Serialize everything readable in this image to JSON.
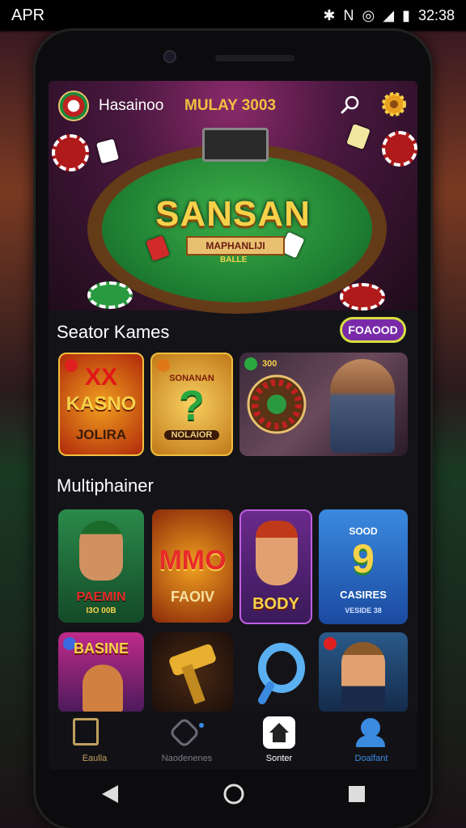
{
  "status_bar": {
    "carrier": "APR",
    "time": "32:38",
    "icons": [
      "bluetooth-icon",
      "nfc-icon",
      "alarm-icon",
      "signal-icon",
      "battery-icon"
    ]
  },
  "header": {
    "brand": "Hasainoo",
    "promo": "MULAY 3003"
  },
  "hero": {
    "title": "SANSAN",
    "banner": "MAPHANLIJI",
    "sub": "BALLE"
  },
  "section1": {
    "title": "Seator Kames",
    "button_label": "FOAOOD",
    "tiles": [
      {
        "line1": "XX",
        "line2": "KASNO",
        "line3": "JOLIRA"
      },
      {
        "line1": "SONANAN",
        "line2": "?",
        "line3": "NOLAIOR"
      },
      {
        "line1": "300"
      }
    ]
  },
  "section2": {
    "title": "Multiphainer",
    "tiles": [
      {
        "line1": "PAEMIN",
        "line2": "I3O 00B"
      },
      {
        "line1": "MMO",
        "line2": "FAOIV"
      },
      {
        "line1": "BODY"
      },
      {
        "line1": "SOOD",
        "line2": "9",
        "line3": "CASIRES",
        "line4": "VESIDE 38"
      },
      {
        "line1": "BASINE"
      },
      {},
      {},
      {}
    ]
  },
  "nav": [
    {
      "label": "Eaulla",
      "icon": "exit-icon",
      "color": "#c0a060"
    },
    {
      "label": "Naodenenes",
      "icon": "tag-icon",
      "color": "#7a7a86"
    },
    {
      "label": "Sonter",
      "icon": "home-icon",
      "color": "#ffffff"
    },
    {
      "label": "Doalfant",
      "icon": "profile-icon",
      "color": "#3a8ae0"
    }
  ],
  "system_nav": [
    "back-icon",
    "home-circle-icon",
    "recents-icon"
  ],
  "colors": {
    "accent": "#7a2aa8",
    "gold": "#f6d24a",
    "felt": "#2a9a40"
  }
}
